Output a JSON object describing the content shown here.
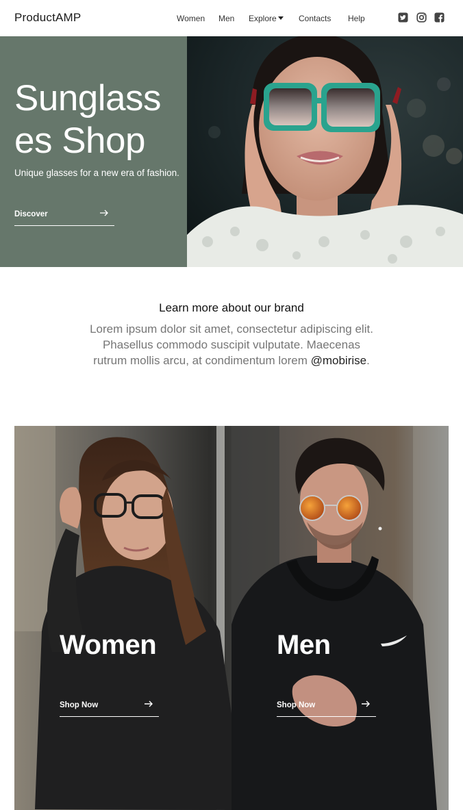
{
  "navbar": {
    "brand": "ProductAMP",
    "links": [
      "Women",
      "Men",
      "Explore",
      "Contacts",
      "Help"
    ],
    "social_icons": [
      "twitter-icon",
      "instagram-icon",
      "facebook-icon"
    ]
  },
  "hero": {
    "title": "Sunglasses Shop",
    "subtitle": "Unique glasses for a new era of fashion.",
    "button_label": "Discover",
    "panel_color": "#66776b"
  },
  "about": {
    "title": "Learn more about our brand",
    "text": "Lorem ipsum dolor sit amet, consectetur adipiscing elit. Phasellus commodo suscipit vulputate. Maecenas rutrum mollis arcu, at condimentum lorem ",
    "mention": "@mobirise",
    "end": "."
  },
  "cards": [
    {
      "title": "Women",
      "button_label": "Shop Now"
    },
    {
      "title": "Men",
      "button_label": "Shop Now"
    }
  ]
}
